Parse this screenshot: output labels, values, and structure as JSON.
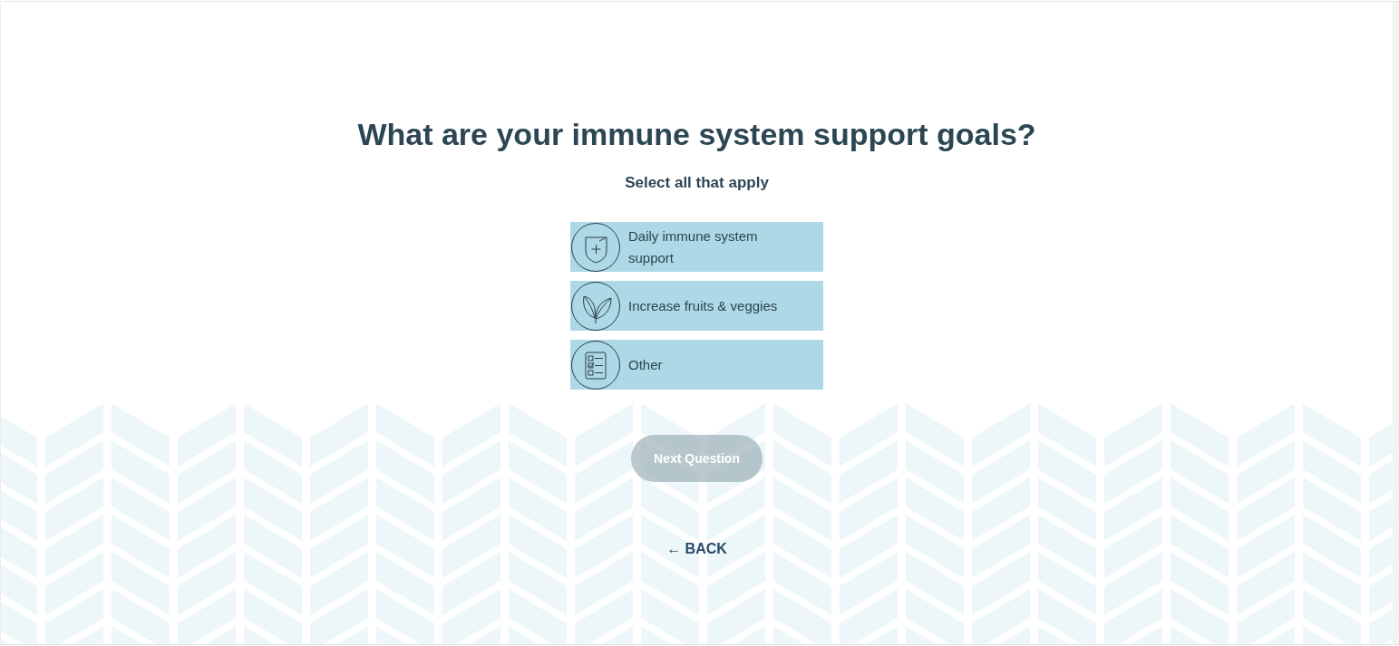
{
  "page": {
    "title": "What are your immune system support goals?",
    "subtitle": "Select all that apply"
  },
  "options": [
    {
      "label": "Daily immune system support",
      "selected": false
    },
    {
      "label": "Increase fruits & veggies",
      "selected": false
    },
    {
      "label": "Other",
      "selected": false
    }
  ],
  "next_button": {
    "label": "Next Question",
    "disabled": true
  },
  "back_link": {
    "label": "← BACK"
  }
}
